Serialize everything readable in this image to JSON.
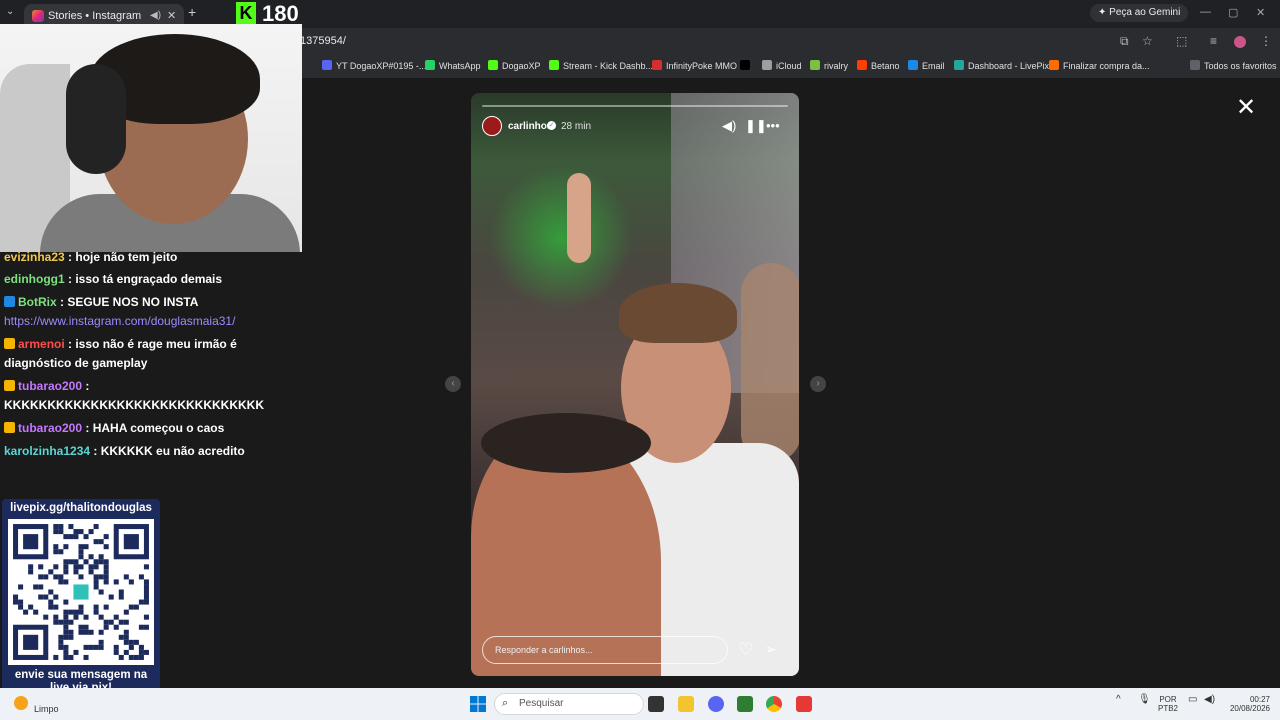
{
  "browser": {
    "tab_title": "Stories • Instagram",
    "tab_mute_icon": "speaker-icon",
    "tab_close": "✕",
    "new_tab": "+",
    "gemini_button": "Peça ao Gemini",
    "url": "1375954/"
  },
  "kick": {
    "viewer_count": "180",
    "logo": "K"
  },
  "bookmarks": [
    {
      "label": "YT DogaoXP#0195 -...",
      "color": "#5865f2"
    },
    {
      "label": "WhatsApp",
      "color": "#25d366"
    },
    {
      "label": "DogaoXP",
      "color": "#53fc18"
    },
    {
      "label": "Stream - Kick Dashb...",
      "color": "#53fc18"
    },
    {
      "label": "InfinityPoke MMO",
      "color": "#d32f2f"
    },
    {
      "label": "",
      "color": "#000000"
    },
    {
      "label": "iCloud",
      "color": "#9e9e9e"
    },
    {
      "label": "rivalry",
      "color": "#7bc043"
    },
    {
      "label": "Betano",
      "color": "#ff3d00"
    },
    {
      "label": "Email",
      "color": "#1e88e5"
    },
    {
      "label": "Dashboard - LivePix",
      "color": "#26a69a"
    },
    {
      "label": "Finalizar compra da...",
      "color": "#ff6d00"
    },
    {
      "label": "Todos os favoritos",
      "color": "#5f6368"
    }
  ],
  "story": {
    "username": "carlinhos",
    "time": "28 min",
    "reply_placeholder": "Responder a carlinhos...",
    "progress": 0.0
  },
  "chat": [
    {
      "user": "evizinha23",
      "text": " : hoje não tem jeito",
      "color": "#f2c94c"
    },
    {
      "user": "edinhogg1",
      "text": " : isso tá engraçado demais",
      "color": "#7fe07f"
    },
    {
      "user": "BotRix",
      "text": " : SEGUE NOS NO INSTA",
      "color": "#7fe07f"
    },
    {
      "user": "",
      "text": "https://www.instagram.com/douglasmaia31/",
      "color": "#9b8cff"
    },
    {
      "user": "armenoi",
      "text": " : isso não é rage meu irmão é",
      "color": "#ff4d4d"
    },
    {
      "user": "",
      "text": "diagnóstico de gameplay",
      "color": "#ffffff"
    },
    {
      "user": "tubarao200",
      "text": " :",
      "color": "#c678ff"
    },
    {
      "user": "",
      "text": "KKKKKKKKKKKKKKKKKKKKKKKKKKKKKK",
      "color": "#ffffff"
    },
    {
      "user": "tubarao200",
      "text": " : HAHA começou o caos",
      "color": "#c678ff"
    },
    {
      "user": "karolzinha1234",
      "text": " : KKKKKK eu não acredito",
      "color": "#5ad6d6"
    }
  ],
  "qr": {
    "top": "livepix.gg/thalitondouglas",
    "bottom_1": "envie sua mensagem na",
    "bottom_2": "live via pix!"
  },
  "taskbar": {
    "weather": "Limpo",
    "search_placeholder": "Pesquisar",
    "lang_1": "POR",
    "lang_2": "PTB2",
    "clock_time": "00:27",
    "clock_date": "20/08/2026"
  }
}
